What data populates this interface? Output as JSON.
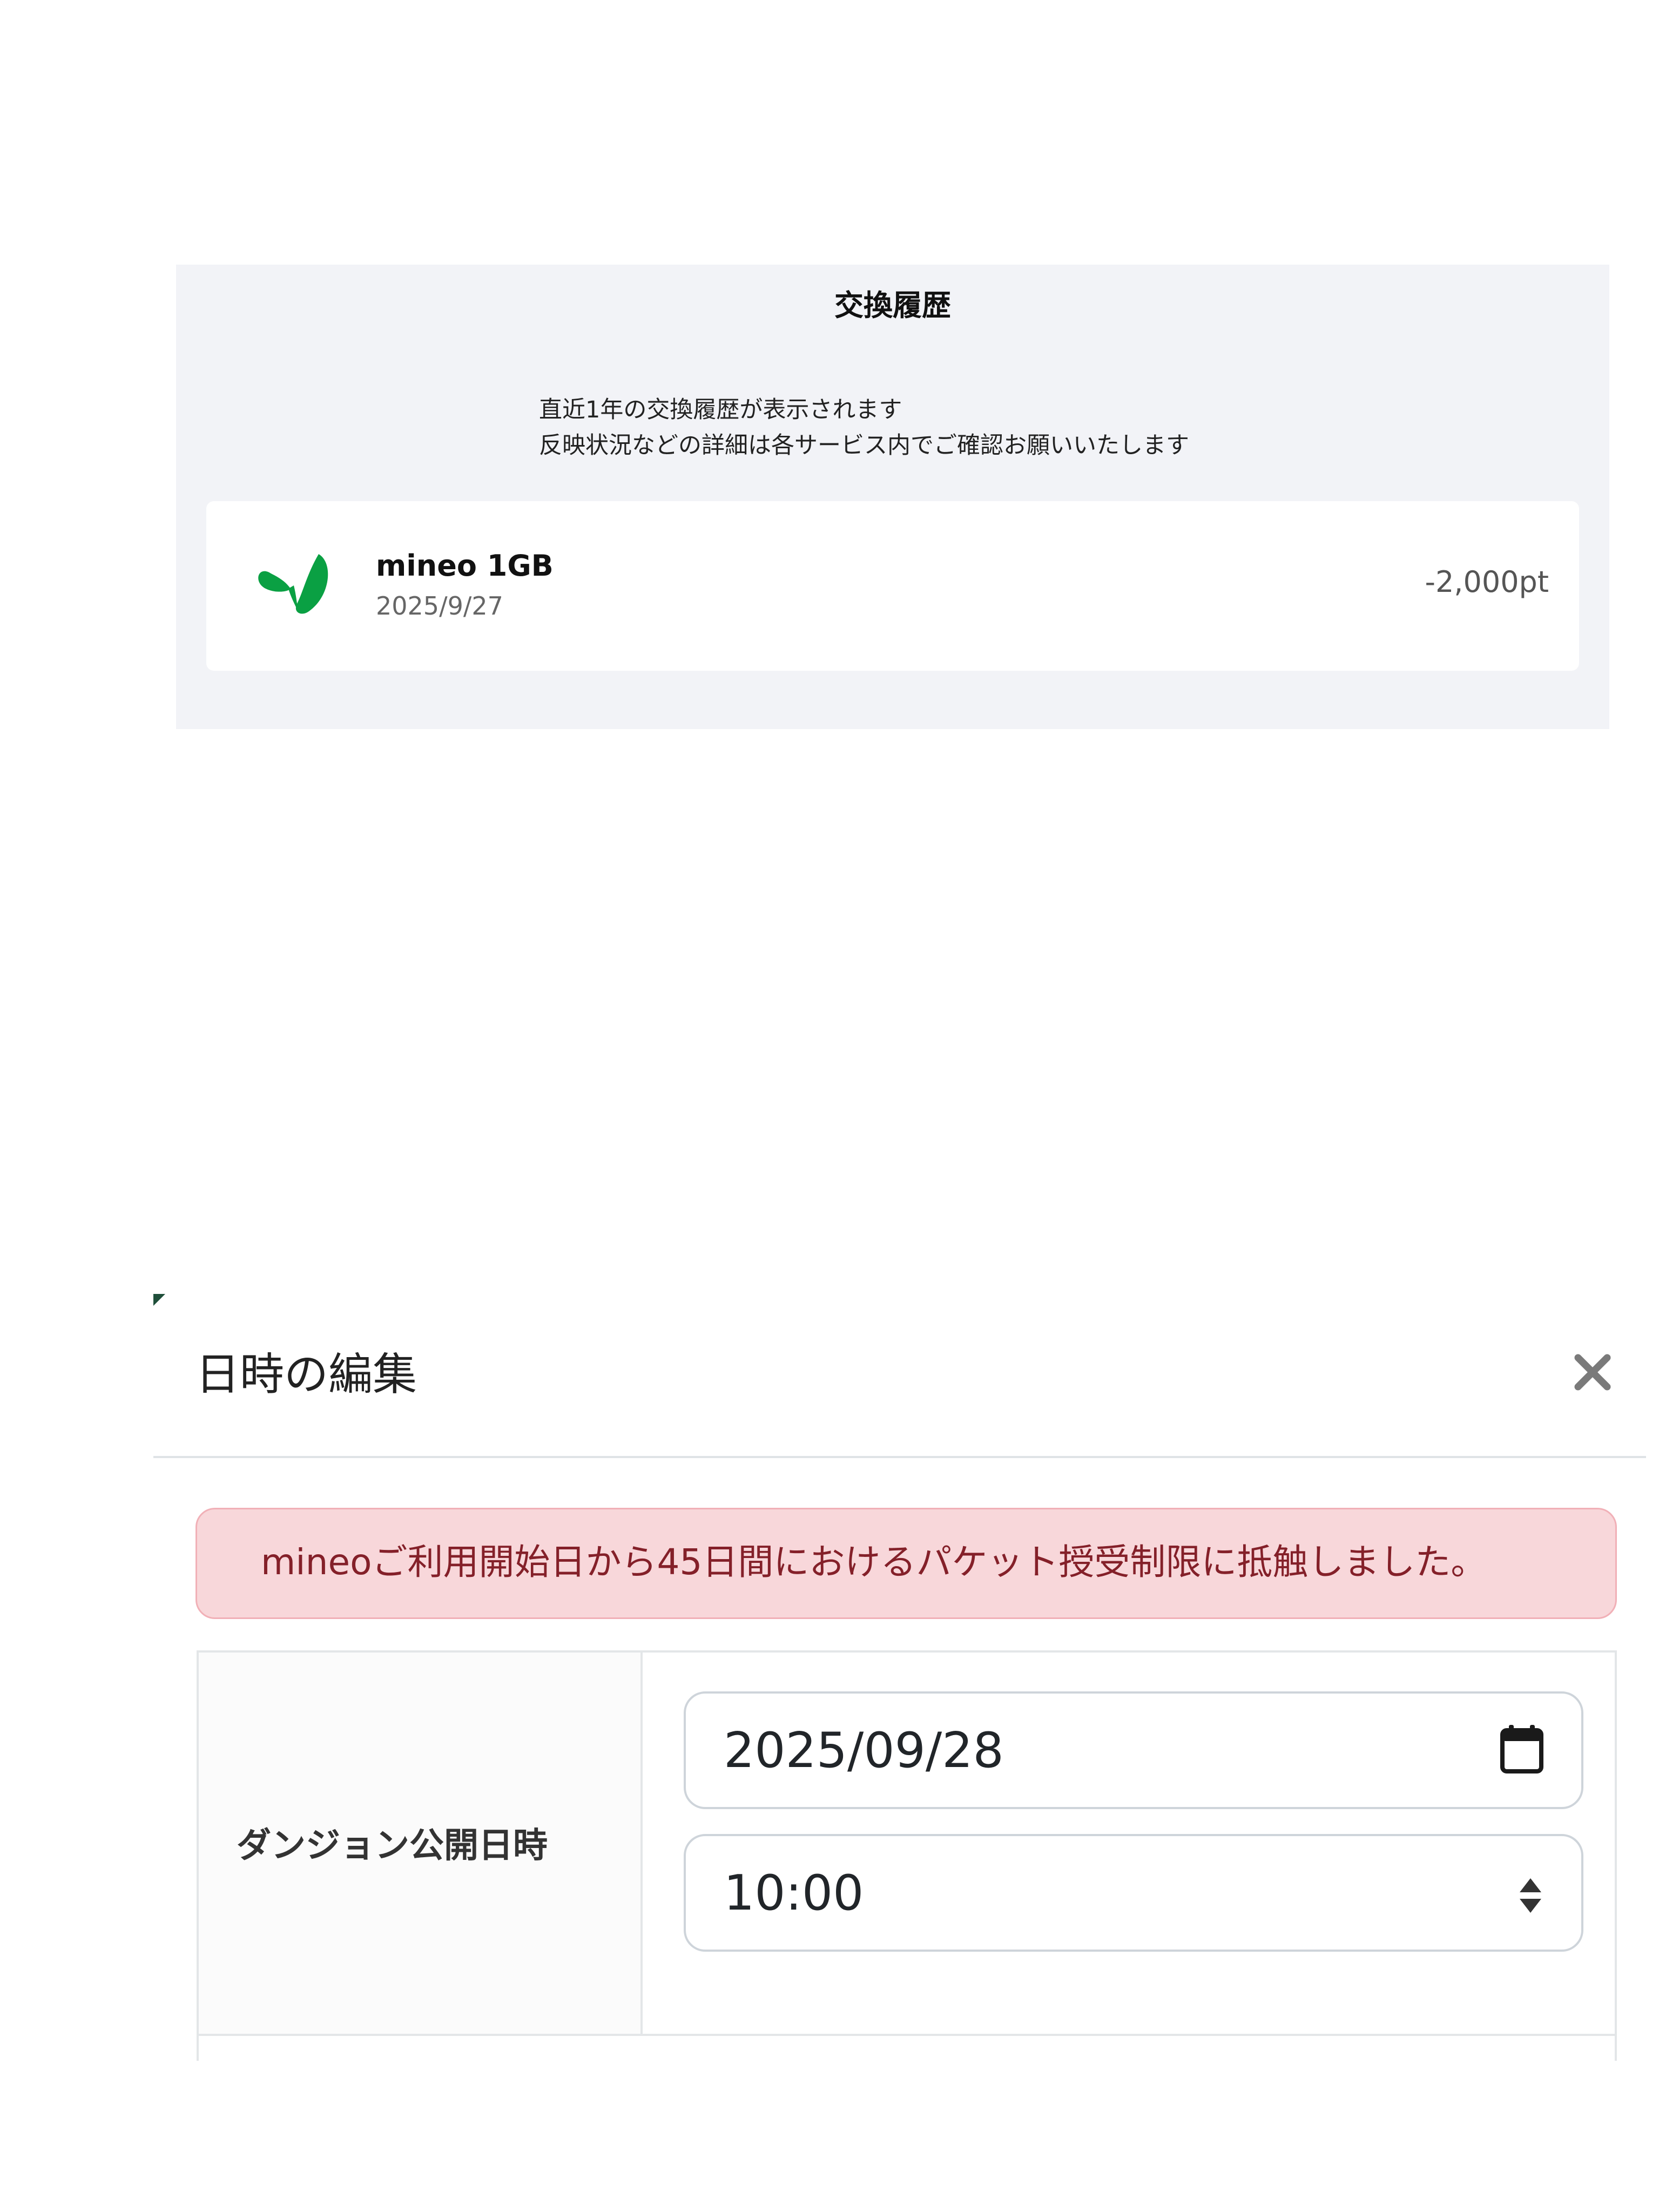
{
  "history": {
    "title": "交換履歴",
    "note_line1": "直近1年の交換履歴が表示されます",
    "note_line2": "反映状況などの詳細は各サービス内でご確認お願いいたします",
    "items": [
      {
        "icon": "mineo-leaf-logo",
        "name": "mineo 1GB",
        "date": "2025/9/27",
        "points": "-2,000pt"
      }
    ]
  },
  "modal": {
    "title": "日時の編集",
    "close_icon": "close-icon",
    "alert": "mineoご利用開始日から45日間におけるパケット授受制限に抵触しました。",
    "field_label": "ダンジョン公開日時",
    "date_value": "2025/09/28",
    "time_value": "10:00",
    "date_icon": "calendar-icon",
    "time_icon": "up-down-arrows-icon"
  },
  "colors": {
    "panel_bg": "#f2f3f7",
    "logo_green": "#0aa043",
    "alert_bg": "#f8d7da",
    "alert_text": "#842029",
    "input_border": "#ced4da"
  }
}
